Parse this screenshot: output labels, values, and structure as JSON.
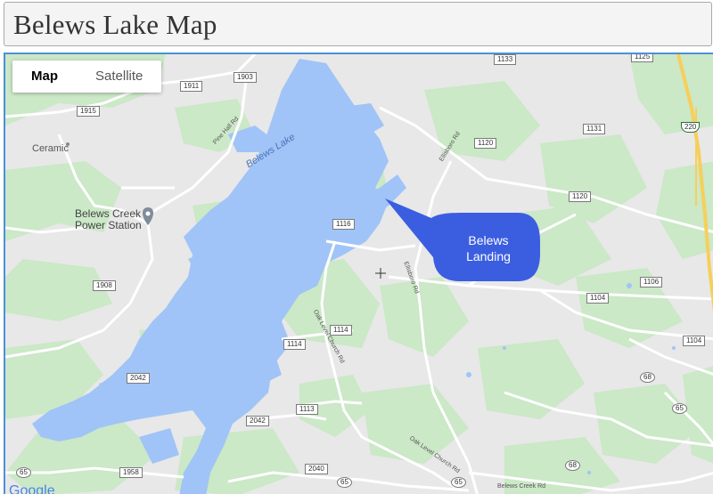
{
  "page": {
    "title": "Belews Lake Map"
  },
  "map": {
    "type_control": {
      "map_label": "Map",
      "satellite_label": "Satellite",
      "selected": "Map"
    },
    "lake_label": "Belews Lake",
    "places": {
      "ceramic": "Ceramic",
      "power_station_line1": "Belews Creek",
      "power_station_line2": "Power Station"
    },
    "roads": {
      "pine_hall": "Pine Hall Rd",
      "ellisboro_a": "Ellisboro Rd",
      "ellisboro_b": "Ellisboro Rd",
      "oak_level_a": "Oak Level Church Rd",
      "oak_level_b": "Oak Level Church Rd",
      "belews_creek": "Belews Creek Rd"
    },
    "route_shields": {
      "r1911": "1911",
      "r1903": "1903",
      "r1915": "1915",
      "r1133": "1133",
      "r1125": "1125",
      "r1120a": "1120",
      "r1131": "1131",
      "r220": "220",
      "r1120b": "1120",
      "r1116": "1116",
      "r1908": "1908",
      "r1104a": "1104",
      "r1106": "1106",
      "r1114a": "1114",
      "r1114b": "1114",
      "r1104b": "1104",
      "r2042a": "2042",
      "r68a": "68",
      "r1113": "1113",
      "r2042b": "2042",
      "r65a": "65",
      "r1958": "1958",
      "r2040": "2040",
      "r65b": "65",
      "r65c": "65",
      "r68b": "68",
      "r65d": "65"
    },
    "marker": {
      "line1": "Belews",
      "line2": "Landing"
    },
    "attribution": "Google",
    "colors": {
      "water": "#a0c4f7",
      "park": "#cbe8c7",
      "land": "#e8e8e8",
      "callout": "#3b5ee0",
      "highway": "#f6cf5b"
    }
  }
}
